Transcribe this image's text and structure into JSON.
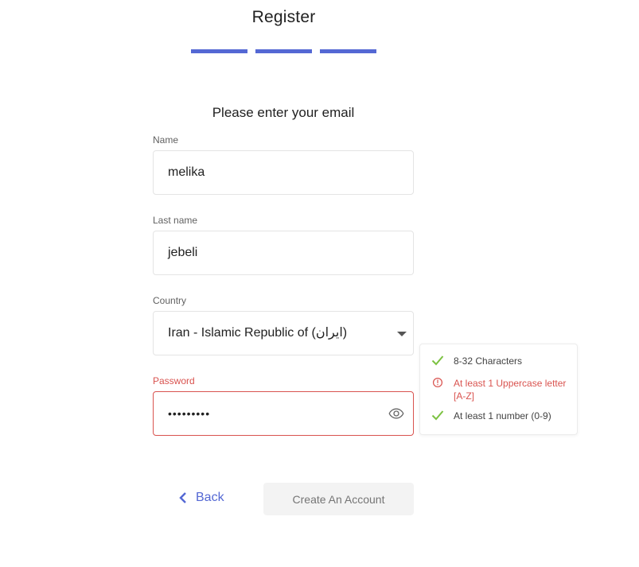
{
  "header": {
    "title": "Register",
    "steps": [
      {
        "name": "step-1",
        "active": true
      },
      {
        "name": "step-2",
        "active": true
      },
      {
        "name": "step-3",
        "active": true
      }
    ],
    "accent": "#5468d4"
  },
  "form": {
    "subtitle": "Please enter your email",
    "name": {
      "label": "Name",
      "value": "melika"
    },
    "last_name": {
      "label": "Last name",
      "value": "jebeli"
    },
    "country": {
      "label": "Country",
      "value": "Iran -  Islamic Republic of (ایران)"
    },
    "password": {
      "label": "Password",
      "value": "•••••••••",
      "state": "error"
    }
  },
  "password_rules": [
    {
      "text": "8-32 Characters",
      "status": "ok",
      "icon": "check-icon"
    },
    {
      "text": "At least 1 Uppercase letter [A-Z]",
      "status": "error",
      "icon": "info-circle-icon"
    },
    {
      "text": "At least 1 number (0-9)",
      "status": "ok",
      "icon": "check-icon"
    }
  ],
  "actions": {
    "back_label": "Back",
    "create_label": "Create An Account"
  },
  "colors": {
    "ok": "#7cc242",
    "error": "#d9534f",
    "accent": "#5468d4"
  }
}
